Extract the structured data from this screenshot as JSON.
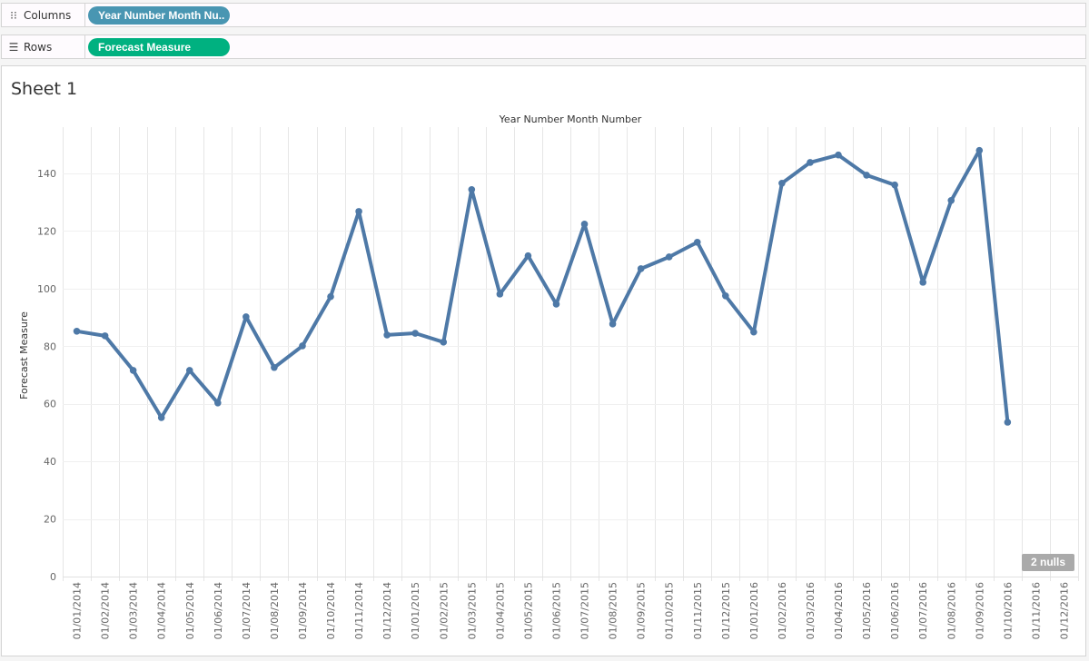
{
  "shelves": {
    "columns": {
      "label": "Columns",
      "icon": "columns-icon",
      "pill": "Year Number Month Nu..",
      "pill_color": "#4996b2"
    },
    "rows": {
      "label": "Rows",
      "icon": "rows-icon",
      "pill": "Forecast Measure",
      "pill_color": "#00b180"
    }
  },
  "sheet": {
    "title": "Sheet 1"
  },
  "nulls_badge": "2 nulls",
  "chart_data": {
    "type": "line",
    "title": "Year Number Month Number",
    "xlabel": "Year Number Month Number",
    "ylabel": "Forecast Measure",
    "ylim": [
      0,
      155
    ],
    "yticks": [
      0,
      20,
      40,
      60,
      80,
      100,
      120,
      140
    ],
    "grid": true,
    "line_color": "#4e79a7",
    "categories": [
      "01/01/2014",
      "01/02/2014",
      "01/03/2014",
      "01/04/2014",
      "01/05/2014",
      "01/06/2014",
      "01/07/2014",
      "01/08/2014",
      "01/09/2014",
      "01/10/2014",
      "01/11/2014",
      "01/12/2014",
      "01/01/2015",
      "01/02/2015",
      "01/03/2015",
      "01/04/2015",
      "01/05/2015",
      "01/06/2015",
      "01/07/2015",
      "01/08/2015",
      "01/09/2015",
      "01/10/2015",
      "01/11/2015",
      "01/12/2015",
      "01/01/2016",
      "01/02/2016",
      "01/03/2016",
      "01/04/2016",
      "01/05/2016",
      "01/06/2016",
      "01/07/2016",
      "01/08/2016",
      "01/09/2016",
      "01/10/2016",
      "01/11/2016",
      "01/12/2016"
    ],
    "series": [
      {
        "name": "Forecast Measure",
        "values": [
          85.2,
          83.6,
          71.6,
          55.2,
          71.6,
          60.3,
          90.2,
          72.6,
          80.1,
          97.2,
          126.8,
          83.9,
          84.5,
          81.4,
          134.4,
          98.1,
          111.4,
          94.6,
          122.4,
          87.7,
          106.9,
          111.0,
          116.1,
          97.5,
          84.9,
          136.6,
          143.8,
          146.4,
          139.4,
          136.0,
          102.2,
          130.6,
          148.0,
          53.6,
          null,
          null
        ]
      }
    ]
  }
}
